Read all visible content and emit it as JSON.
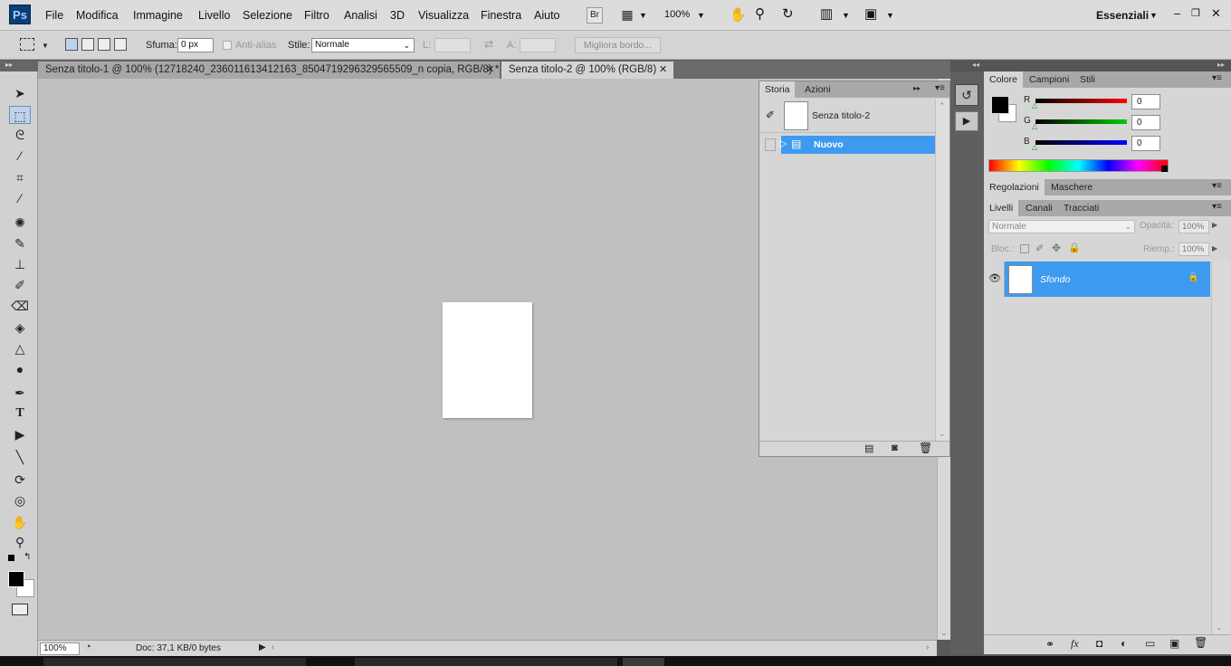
{
  "menubar": {
    "logo": "Ps",
    "items": [
      "File",
      "Modifica",
      "Immagine",
      "Livello",
      "Selezione",
      "Filtro",
      "Analisi",
      "3D",
      "Visualizza",
      "Finestra",
      "Aiuto"
    ],
    "bridge_label": "Br",
    "zoom": "100%",
    "workspace": "Essenziali"
  },
  "options": {
    "sfuma_label": "Sfuma:",
    "sfuma_value": "0 px",
    "antialias_label": "Anti-alias",
    "stile_label": "Stile:",
    "stile_value": "Normale",
    "l_label": "L:",
    "a_label": "A:",
    "migliora_label": "Migliora bordo..."
  },
  "tabs": [
    {
      "label": "Senza titolo-1 @ 100% (12718240_236011613412163_8504719296329565509_n copia, RGB/8) *"
    },
    {
      "label": "Senza titolo-2 @ 100% (RGB/8)"
    }
  ],
  "status": {
    "zoom": "100%",
    "doc": "Doc: 37,1 KB/0 bytes"
  },
  "storia": {
    "tab_storia": "Storia",
    "tab_azioni": "Azioni",
    "snapshot_label": "Senza titolo-2",
    "step_label": "Nuovo"
  },
  "colore": {
    "tabs": [
      "Colore",
      "Campioni",
      "Stili"
    ],
    "channels": [
      {
        "label": "R",
        "value": "0"
      },
      {
        "label": "G",
        "value": "0"
      },
      {
        "label": "B",
        "value": "0"
      }
    ]
  },
  "regolazioni": {
    "tabs": [
      "Regolazioni",
      "Maschere"
    ]
  },
  "livelli": {
    "tabs": [
      "Livelli",
      "Canali",
      "Tracciati"
    ],
    "blend": "Normale",
    "opacity_label": "Opacità:",
    "opacity_value": "100%",
    "lock_label": "Bloc.:",
    "fill_label": "Riemp.:",
    "fill_value": "100%",
    "layer_name": "Sfondo"
  },
  "colors": {
    "selection_blue": "#3d9aef",
    "canvas_bg": "#c0c0c0"
  }
}
